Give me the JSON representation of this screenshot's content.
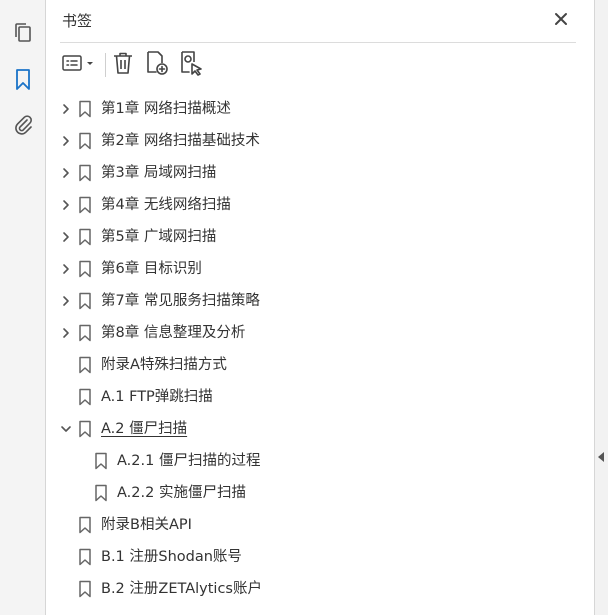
{
  "panel": {
    "title": "书签"
  },
  "icons": {
    "rail": [
      "pages-icon",
      "bookmark-icon",
      "attachment-icon"
    ],
    "toolbar": [
      "options-icon",
      "delete-icon",
      "new-bookmark-icon",
      "new-bookmark-from-structure-icon"
    ],
    "close": "close-icon",
    "accent": "#1a73c8"
  },
  "bookmarks": [
    {
      "label": "第1章 网络扫描概述",
      "level": 0,
      "expandable": true,
      "expanded": false
    },
    {
      "label": "第2章 网络扫描基础技术",
      "level": 0,
      "expandable": true,
      "expanded": false
    },
    {
      "label": "第3章 局域网扫描",
      "level": 0,
      "expandable": true,
      "expanded": false
    },
    {
      "label": "第4章 无线网络扫描",
      "level": 0,
      "expandable": true,
      "expanded": false
    },
    {
      "label": "第5章 广域网扫描",
      "level": 0,
      "expandable": true,
      "expanded": false
    },
    {
      "label": "第6章 目标识别",
      "level": 0,
      "expandable": true,
      "expanded": false
    },
    {
      "label": "第7章 常见服务扫描策略",
      "level": 0,
      "expandable": true,
      "expanded": false
    },
    {
      "label": "第8章 信息整理及分析",
      "level": 0,
      "expandable": true,
      "expanded": false
    },
    {
      "label": "附录A特殊扫描方式",
      "level": 0,
      "expandable": false,
      "expanded": false
    },
    {
      "label": "A.1 FTP弹跳扫描",
      "level": 0,
      "expandable": false,
      "expanded": false
    },
    {
      "label": "A.2 僵尸扫描",
      "level": 0,
      "expandable": true,
      "expanded": true,
      "selected": true
    },
    {
      "label": "A.2.1 僵尸扫描的过程",
      "level": 1,
      "expandable": false,
      "expanded": false
    },
    {
      "label": "A.2.2 实施僵尸扫描",
      "level": 1,
      "expandable": false,
      "expanded": false
    },
    {
      "label": "附录B相关API",
      "level": 0,
      "expandable": false,
      "expanded": false
    },
    {
      "label": "B.1 注册Shodan账号",
      "level": 0,
      "expandable": false,
      "expanded": false
    },
    {
      "label": "B.2 注册ZETAlytics账户",
      "level": 0,
      "expandable": false,
      "expanded": false
    }
  ]
}
